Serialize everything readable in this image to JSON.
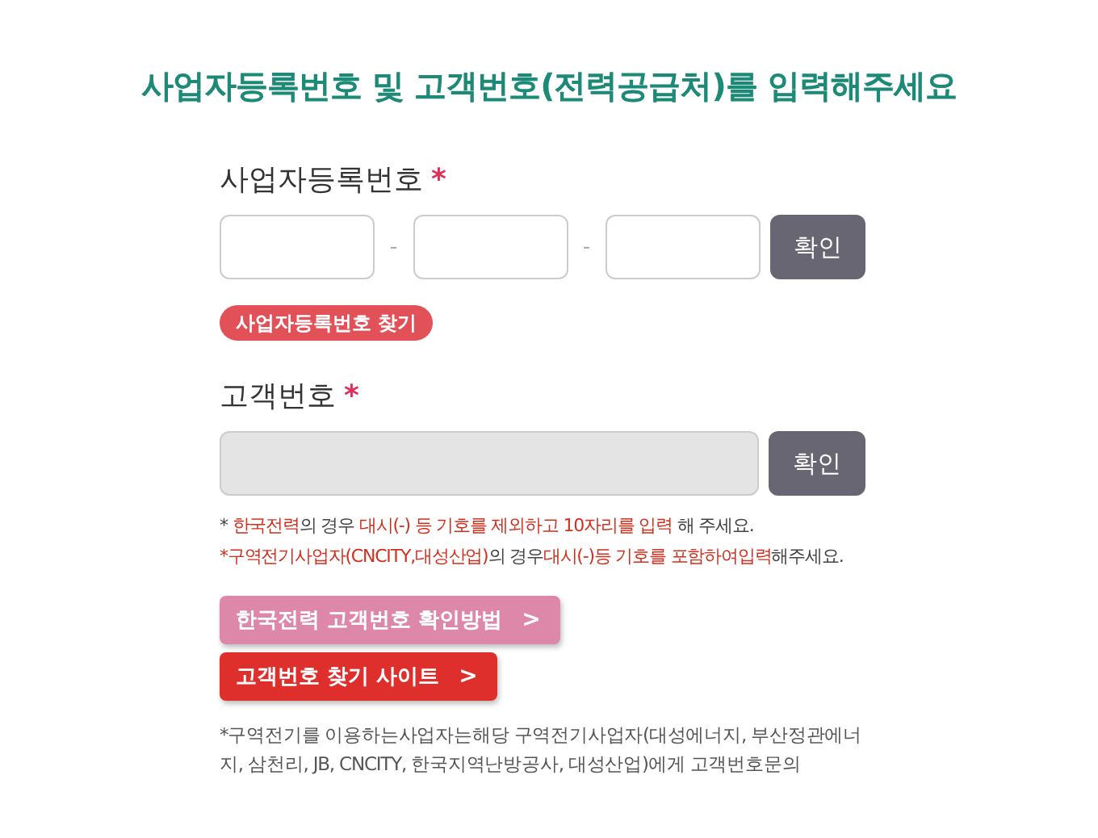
{
  "title": "사업자등록번호 및 고객번호(전력공급처)를 입력해주세요",
  "business_number": {
    "label": "사업자등록번호",
    "required_mark": "*",
    "separators": [
      "-",
      "-"
    ],
    "confirm_button": "확인",
    "find_button": "사업자등록번호 찾기",
    "fields": [
      {
        "disabled": false
      },
      {
        "disabled": false
      },
      {
        "disabled": false
      }
    ]
  },
  "customer_number": {
    "label": "고객번호",
    "required_mark": "*",
    "disabled": true,
    "confirm_button": "확인"
  },
  "notes": [
    [
      {
        "kind": "plain",
        "text": "* "
      },
      {
        "kind": "highlight",
        "text": "한국전력"
      },
      {
        "kind": "plain",
        "text": "의 경우 "
      },
      {
        "kind": "highlight",
        "text": "대시(-) 등 기호를 제외하고 10자리를 입력"
      },
      {
        "kind": "plain",
        "text": " 해 주세요."
      }
    ],
    [
      {
        "kind": "highlight",
        "text": "*구역전기사업자(CNCITY,대성산업)"
      },
      {
        "kind": "plain",
        "text": "의 경우"
      },
      {
        "kind": "highlight",
        "text": "대시(-)등 기호를 포함하여입력"
      },
      {
        "kind": "plain",
        "text": "해주세요."
      }
    ]
  ],
  "link_buttons": [
    {
      "kind": "pink",
      "label": "한국전력 고객번호 확인방법",
      "arrow": ">"
    },
    {
      "kind": "red",
      "label": "고객번호 찾기 사이트",
      "arrow": ">"
    }
  ],
  "footnote": "*구역전기를 이용하는사업자는해당 구역전기사업자(대성에너지, 부산정관에너지, 삼천리, JB, CNCITY, 한국지역난방공사, 대성산업)에게 고객번호문의"
}
